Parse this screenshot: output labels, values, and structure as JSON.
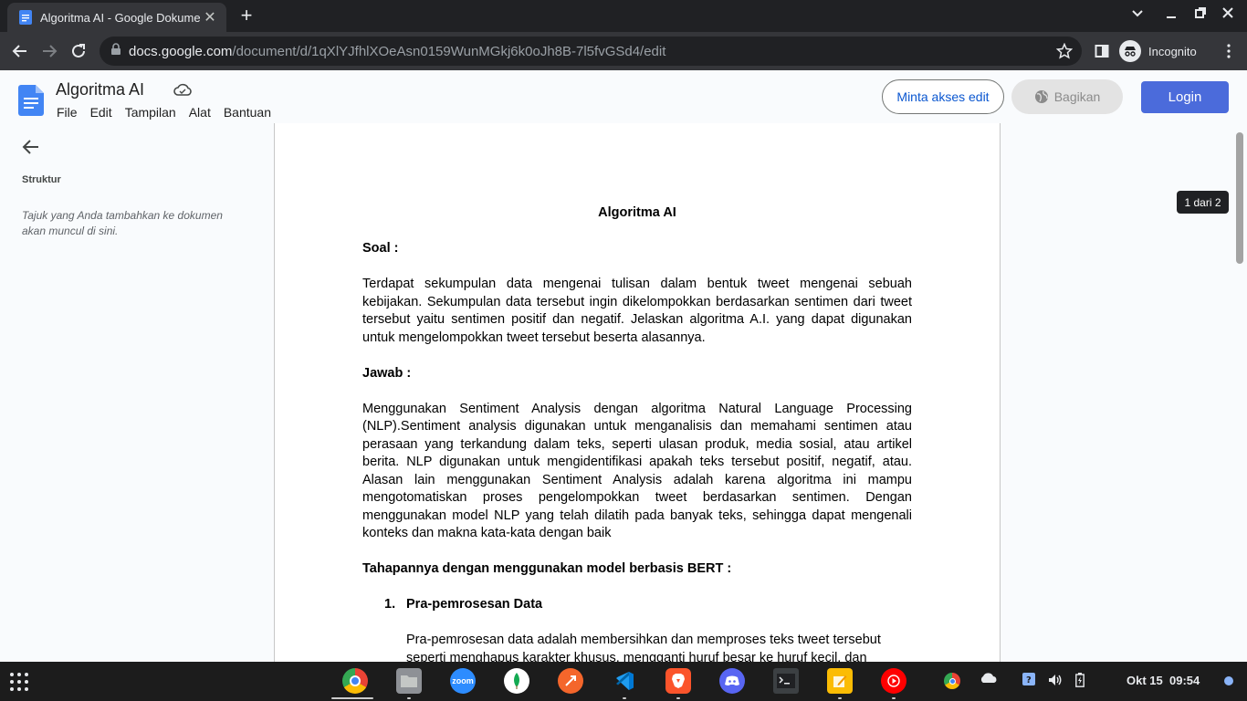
{
  "browser": {
    "tab_title": "Algoritma AI - Google Dokumen",
    "url_host": "docs.google.com",
    "url_path": "/document/d/1qXlYJfhlXOeAsn0159WunMGkj6k0oJh8B-7l5fvGSd4/edit",
    "profile_label": "Incognito"
  },
  "docs": {
    "title": "Algoritma AI",
    "menu": [
      "File",
      "Edit",
      "Tampilan",
      "Alat",
      "Bantuan"
    ],
    "request_edit_label": "Minta akses edit",
    "share_label": "Bagikan",
    "login_label": "Login",
    "page_indicator": "1 dari 2"
  },
  "sidebar": {
    "title": "Struktur",
    "hint": "Tajuk yang Anda tambahkan ke dokumen akan muncul di sini."
  },
  "document": {
    "heading": "Algoritma AI",
    "soal_label": "Soal :",
    "soal_text": "Terdapat sekumpulan data mengenai tulisan dalam bentuk tweet mengenai sebuah kebijakan. Sekumpulan data tersebut ingin dikelompokkan berdasarkan sentimen dari tweet tersebut yaitu sentimen positif dan negatif. Jelaskan algoritma A.I. yang dapat digunakan untuk mengelompokkan tweet tersebut beserta alasannya.",
    "jawab_label": "Jawab :",
    "jawab_text": "Menggunakan Sentiment Analysis dengan algoritma Natural Language Processing (NLP).Sentiment analysis digunakan untuk menganalisis dan memahami sentimen atau perasaan yang terkandung dalam teks, seperti ulasan produk, media sosial, atau artikel berita. NLP digunakan untuk mengidentifikasi apakah teks tersebut positif, negatif, atau. Alasan lain menggunakan Sentiment Analysis adalah karena algoritma ini mampu mengotomatiskan proses pengelompokkan tweet berdasarkan sentimen. Dengan menggunakan model NLP yang telah dilatih pada banyak teks, sehingga dapat mengenali konteks dan makna kata-kata dengan baik",
    "steps_heading": "Tahapannya dengan menggunakan model berbasis BERT :",
    "step1_number": "1.",
    "step1_title": "Pra-pemrosesan Data",
    "step1_text": "Pra-pemrosesan data adalah membersihkan dan memproses teks tweet tersebut seperti menghapus karakter khusus, mengganti huruf besar ke huruf kecil, dan"
  },
  "taskbar": {
    "zoom_label": "zoom",
    "date": "Okt 15",
    "time": "09:54"
  },
  "colors": {
    "accent": "#0b57d0",
    "login_bg": "#4b6bdb",
    "docs_blue": "#4285f4"
  }
}
